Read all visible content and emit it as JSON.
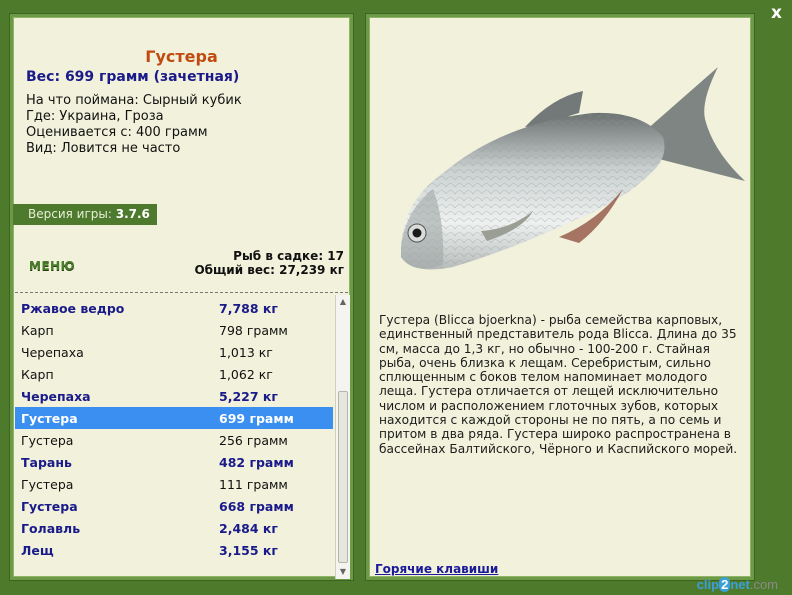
{
  "close_label": "x",
  "fish": {
    "name": "Густера",
    "weight_line": "Вес: 699 грамм (зачетная)",
    "caught_on": "На что поймана: Сырный кубик",
    "where": "Где: Украина, Гроза",
    "valued_from": "Оценивается с: 400 грамм",
    "kind": "Вид: Ловится не часто"
  },
  "version": {
    "label": "Версия игры:",
    "value": "3.7.6"
  },
  "menu_label": "МЕНЮ",
  "keep": {
    "count_line": "Рыб в садке: 17",
    "total_line": "Общий вес: 27,239 кг"
  },
  "catch_list": [
    {
      "name": "Ржавое ведро",
      "weight": "7,788 кг",
      "bold": true
    },
    {
      "name": "Карп",
      "weight": "798 грамм",
      "bold": false
    },
    {
      "name": "Черепаха",
      "weight": "1,013 кг",
      "bold": false
    },
    {
      "name": "Карп",
      "weight": "1,062 кг",
      "bold": false
    },
    {
      "name": "Черепаха",
      "weight": "5,227 кг",
      "bold": true
    },
    {
      "name": "Густера",
      "weight": "699 грамм",
      "bold": true,
      "selected": true
    },
    {
      "name": "Густера",
      "weight": "256 грамм",
      "bold": false
    },
    {
      "name": "Тарань",
      "weight": "482 грамм",
      "bold": true
    },
    {
      "name": "Густера",
      "weight": "111 грамм",
      "bold": false
    },
    {
      "name": "Густера",
      "weight": "668 грамм",
      "bold": true
    },
    {
      "name": "Голавль",
      "weight": "2,484 кг",
      "bold": true
    },
    {
      "name": "Лещ",
      "weight": "3,155 кг",
      "bold": true
    }
  ],
  "description": "Густера (Blicca bjoerkna) - рыба семейства карповых, единственный представитель рода Blicca. Длина до 35 см, масса до 1,3 кг, но обычно - 100-200 г. Стайная рыба, очень близка к лещам. Серебристым, сильно сплющенным с боков телом напоминает молодого леща. Густера отличается от лещей исключительно числом и расположением глоточных зубов, которых находится с каждой стороны не по пять, а по семь и притом в два ряда. Густера широко распространена в бассейнах Балтийского, Чёрного и Каспийского морей.",
  "hotkeys_label": "Горячие клавиши",
  "watermark": {
    "pre": "clip",
    "mid": "2",
    "post": "net",
    "tld": ".com"
  },
  "colors": {
    "background": "#4e7a2c",
    "panel": "#f2f2dc",
    "fish_name": "#c04a10",
    "bold_text": "#1a1a8a",
    "selection": "#3b8ff0"
  }
}
